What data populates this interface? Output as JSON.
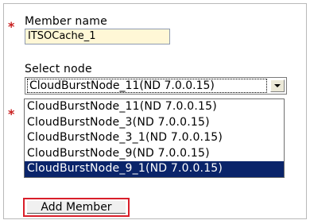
{
  "form": {
    "member_name_label": "Member name",
    "member_name_value": "ITSOCache_1",
    "select_node_label": "Select node",
    "selected_node": "CloudBurstNode_11(ND 7.0.0.15)",
    "options": [
      "CloudBurstNode_11(ND 7.0.0.15)",
      "CloudBurstNode_3(ND 7.0.0.15)",
      "CloudBurstNode_3_1(ND 7.0.0.15)",
      "CloudBurstNode_9(ND 7.0.0.15)",
      "CloudBurstNode_9_1(ND 7.0.0.15)"
    ],
    "highlighted_option": "CloudBurstNode_9_1(ND 7.0.0.15)",
    "add_button_label": "Add Member",
    "required_marker": "*"
  },
  "colors": {
    "required": "#c81e1e",
    "input_background": "#fff7d6",
    "highlight": "#0a246a",
    "button_outline": "#d91e2a"
  }
}
